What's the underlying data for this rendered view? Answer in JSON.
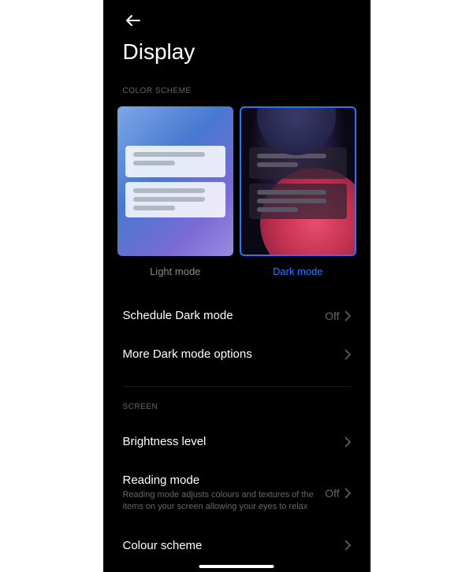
{
  "header": {
    "title": "Display"
  },
  "colorScheme": {
    "sectionLabel": "COLOR SCHEME",
    "options": {
      "light": "Light mode",
      "dark": "Dark mode"
    },
    "selected": "dark"
  },
  "settings": {
    "scheduleDark": {
      "title": "Schedule Dark mode",
      "value": "Off"
    },
    "moreDarkOptions": {
      "title": "More Dark mode options"
    }
  },
  "screen": {
    "sectionLabel": "SCREEN",
    "brightness": {
      "title": "Brightness level"
    },
    "readingMode": {
      "title": "Reading mode",
      "subtitle": "Reading mode adjusts colours and textures of the items on your screen allowing your eyes to relax",
      "value": "Off"
    },
    "colourScheme": {
      "title": "Colour scheme"
    }
  }
}
